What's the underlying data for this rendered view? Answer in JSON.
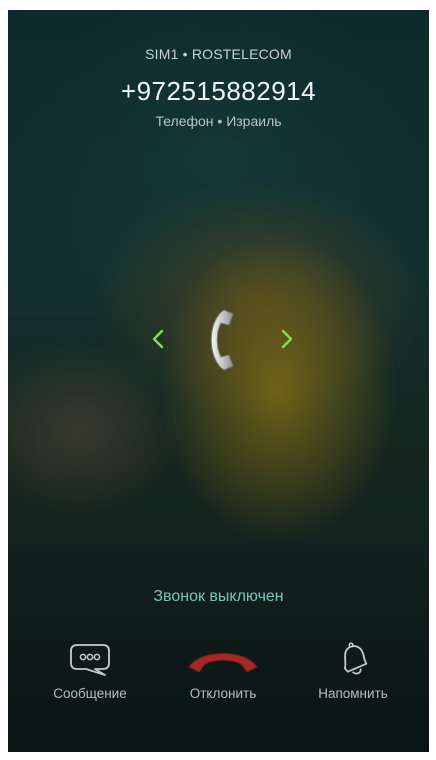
{
  "call": {
    "sim_label": "SIM1 • ROSTELECOM",
    "number": "+972515882914",
    "caller_info": "Телефон • Израиль",
    "status": "Звонок выключен"
  },
  "slider": {
    "left_icon": "chevron-left-icon",
    "center_icon": "handset-icon",
    "right_icon": "chevron-right-icon",
    "arrow_color": "#7ee05a"
  },
  "actions": [
    {
      "label": "Сообщение",
      "icon": "message-bubble-icon"
    },
    {
      "label": "Отклонить",
      "icon": "decline-handset-icon",
      "color": "#c0302c"
    },
    {
      "label": "Напомнить",
      "icon": "bell-icon"
    }
  ]
}
